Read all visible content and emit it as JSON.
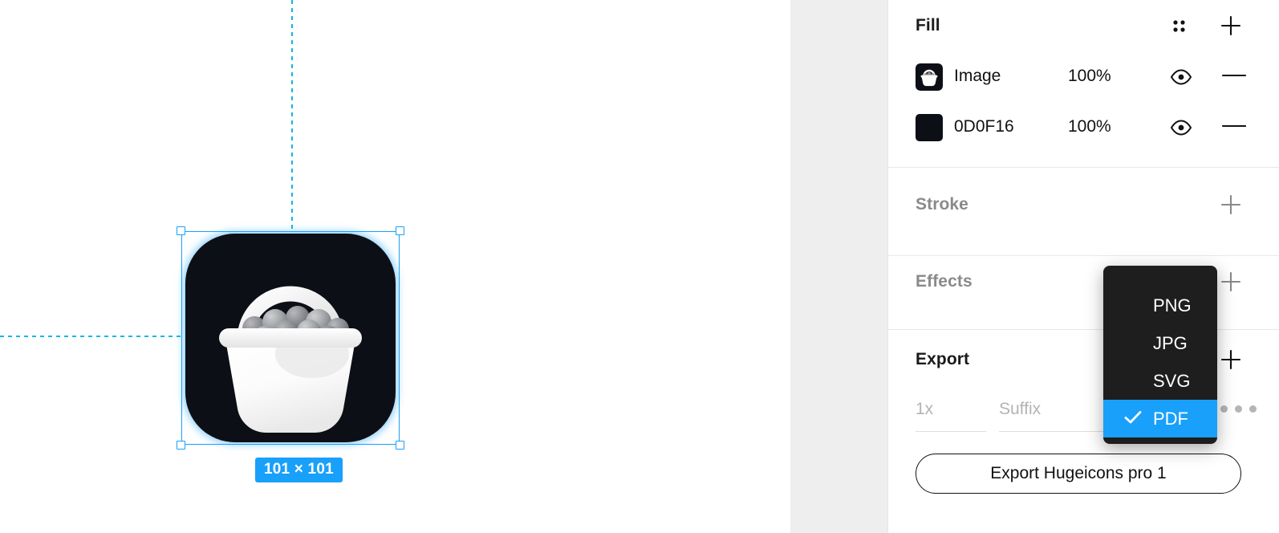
{
  "canvas": {
    "selection": {
      "dimension_badge": "101 × 101",
      "selection_color": "#18a0fb",
      "artwork_name": "basket-icon",
      "artwork_background": "#0d0f16"
    },
    "guides": {
      "color": "#19b5e0"
    }
  },
  "panel": {
    "fill": {
      "title": "Fill",
      "grid_icon": "grid-dots-icon",
      "add_icon": "plus-icon",
      "rows": [
        {
          "swatch": "image-thumbnail",
          "label": "Image",
          "opacity": "100%",
          "visibility_icon": "eye-icon",
          "remove_icon": "minus-icon"
        },
        {
          "swatch": "color-swatch",
          "color": "#0D0F16",
          "label": "0D0F16",
          "opacity": "100%",
          "visibility_icon": "eye-icon",
          "remove_icon": "minus-icon"
        }
      ]
    },
    "stroke": {
      "title": "Stroke",
      "add_icon": "plus-icon"
    },
    "effects": {
      "title": "Effects",
      "add_icon": "plus-icon"
    },
    "export": {
      "title": "Export",
      "add_icon": "plus-icon",
      "scale": "1x",
      "suffix_placeholder": "Suffix",
      "format": "PDF",
      "more_icon": "ellipsis-icon",
      "button_label": "Export Hugeicons pro 1"
    }
  },
  "format_dropdown": {
    "options": [
      "PNG",
      "JPG",
      "SVG",
      "PDF"
    ],
    "selected": "PDF",
    "selected_color": "#18a0fb",
    "check_icon": "check-icon",
    "background": "#1e1e1e"
  }
}
